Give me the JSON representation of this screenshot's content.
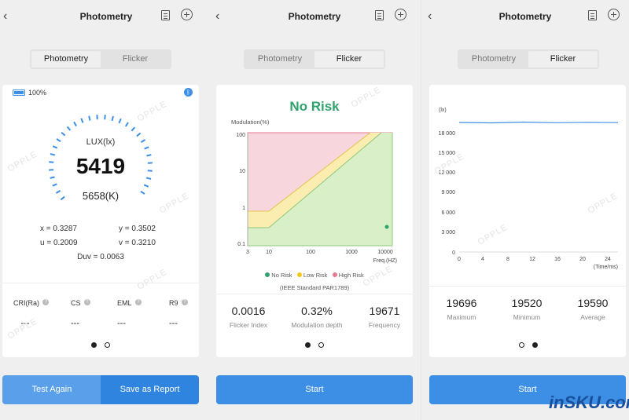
{
  "panel1": {
    "title": "Photometry",
    "tabs": [
      "Photometry",
      "Flicker"
    ],
    "battery": "100%",
    "gauge_label": "LUX(lx)",
    "lux": "5419",
    "cct": "5658(K)",
    "x": "x = 0.3287",
    "y": "y = 0.3502",
    "u": "u = 0.2009",
    "v": "v = 0.3210",
    "duv": "Duv = 0.0063",
    "metrics": [
      {
        "label": "CRI(Ra)",
        "value": "---"
      },
      {
        "label": "CS",
        "value": "---"
      },
      {
        "label": "EML",
        "value": "---"
      },
      {
        "label": "R9",
        "value": "---"
      }
    ],
    "btn_test": "Test Again",
    "btn_save": "Save as Report",
    "watermark": "OPPLE"
  },
  "panel2": {
    "title": "Photometry",
    "tabs": [
      "Photometry",
      "Flicker"
    ],
    "risk": "No Risk",
    "ylabel": "Modulation(%)",
    "xlabel": "Freq.(HZ)",
    "yticks": [
      "100",
      "10",
      "1",
      "0.1"
    ],
    "xticks": [
      "3",
      "10",
      "100",
      "1000",
      "10000"
    ],
    "legend": [
      "No Risk",
      "Low Risk",
      "High Risk"
    ],
    "standard": "(IEEE Standard PAR1789)",
    "stats": [
      {
        "value": "0.0016",
        "label": "Flicker Index"
      },
      {
        "value": "0.32%",
        "label": "Modulation depth"
      },
      {
        "value": "19671",
        "label": "Frequency"
      }
    ],
    "btn_start": "Start",
    "colors": {
      "green": "#2fa36b",
      "yellow": "#f5c518",
      "red": "#e8788c"
    }
  },
  "panel3": {
    "title": "Photometry",
    "tabs": [
      "Photometry",
      "Flicker"
    ],
    "ylabel": "(lx)",
    "xlabel": "(Time/ms)",
    "yticks": [
      "18 000",
      "15 000",
      "12 000",
      "9 000",
      "6 000",
      "3 000",
      "0"
    ],
    "xticks": [
      "0",
      "4",
      "8",
      "12",
      "16",
      "20",
      "24"
    ],
    "stats": [
      {
        "value": "19696",
        "label": "Maximum"
      },
      {
        "value": "19520",
        "label": "Minimum"
      },
      {
        "value": "19590",
        "label": "Average"
      }
    ],
    "btn_start": "Start",
    "brand": "inSKU.com"
  }
}
